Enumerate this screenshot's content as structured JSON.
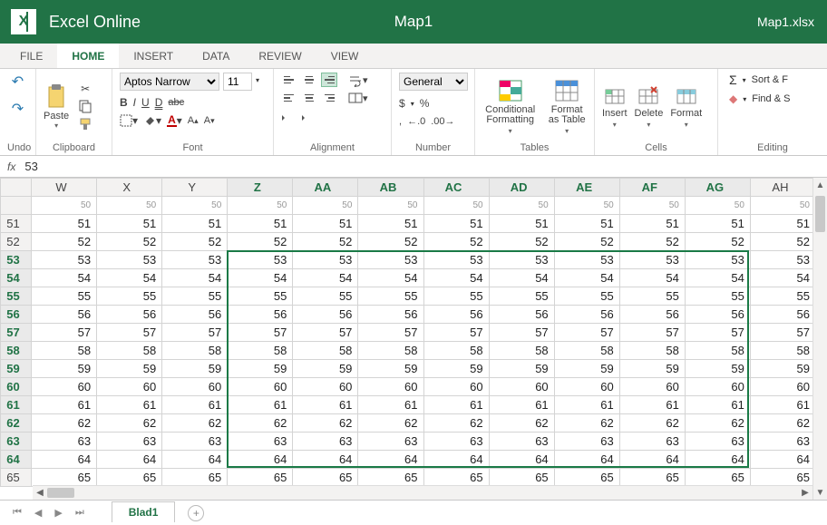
{
  "app": {
    "name": "Excel Online",
    "doc_title": "Map1",
    "file_name": "Map1.xlsx"
  },
  "menu": {
    "file": "FILE",
    "home": "HOME",
    "insert": "INSERT",
    "data": "DATA",
    "review": "REVIEW",
    "view": "VIEW"
  },
  "ribbon": {
    "undo_label": "Undo",
    "clipboard": {
      "paste": "Paste",
      "label": "Clipboard"
    },
    "font": {
      "family": "Aptos Narrow",
      "size": "11",
      "label": "Font",
      "bold": "B",
      "italic": "I",
      "underline": "U",
      "dunder": "D",
      "strike": "abc",
      "a": "A"
    },
    "alignment": {
      "label": "Alignment"
    },
    "number": {
      "format": "General",
      "pct": "%",
      "dollar": "$",
      "comma": ",",
      "inc": ".0",
      "dec": ".00",
      "label": "Number"
    },
    "tables": {
      "cond": "Conditional Formatting",
      "fmt_table": "Format as Table",
      "label": "Tables"
    },
    "cells": {
      "insert": "Insert",
      "delete": "Delete",
      "format": "Format",
      "label": "Cells"
    },
    "editing": {
      "sort": "Sort & F",
      "find": "Find & S",
      "label": "Editing",
      "sigma": "Σ"
    }
  },
  "formula": {
    "fx": "fx",
    "value": "53"
  },
  "grid": {
    "columns": [
      "W",
      "X",
      "Y",
      "Z",
      "AA",
      "AB",
      "AC",
      "AD",
      "AE",
      "AF",
      "AG",
      "AH"
    ],
    "col_hl_start": 3,
    "col_hl_end": 10,
    "first_row_partial": 50,
    "rows": [
      50,
      51,
      52,
      53,
      54,
      55,
      56,
      57,
      58,
      59,
      60,
      61,
      62,
      63,
      64,
      65
    ],
    "row_hl_start": 53,
    "row_hl_end": 64,
    "sel": {
      "row_start": 53,
      "row_end": 64,
      "col_start": 3,
      "col_end": 10
    }
  },
  "sheets": {
    "active": "Blad1"
  }
}
